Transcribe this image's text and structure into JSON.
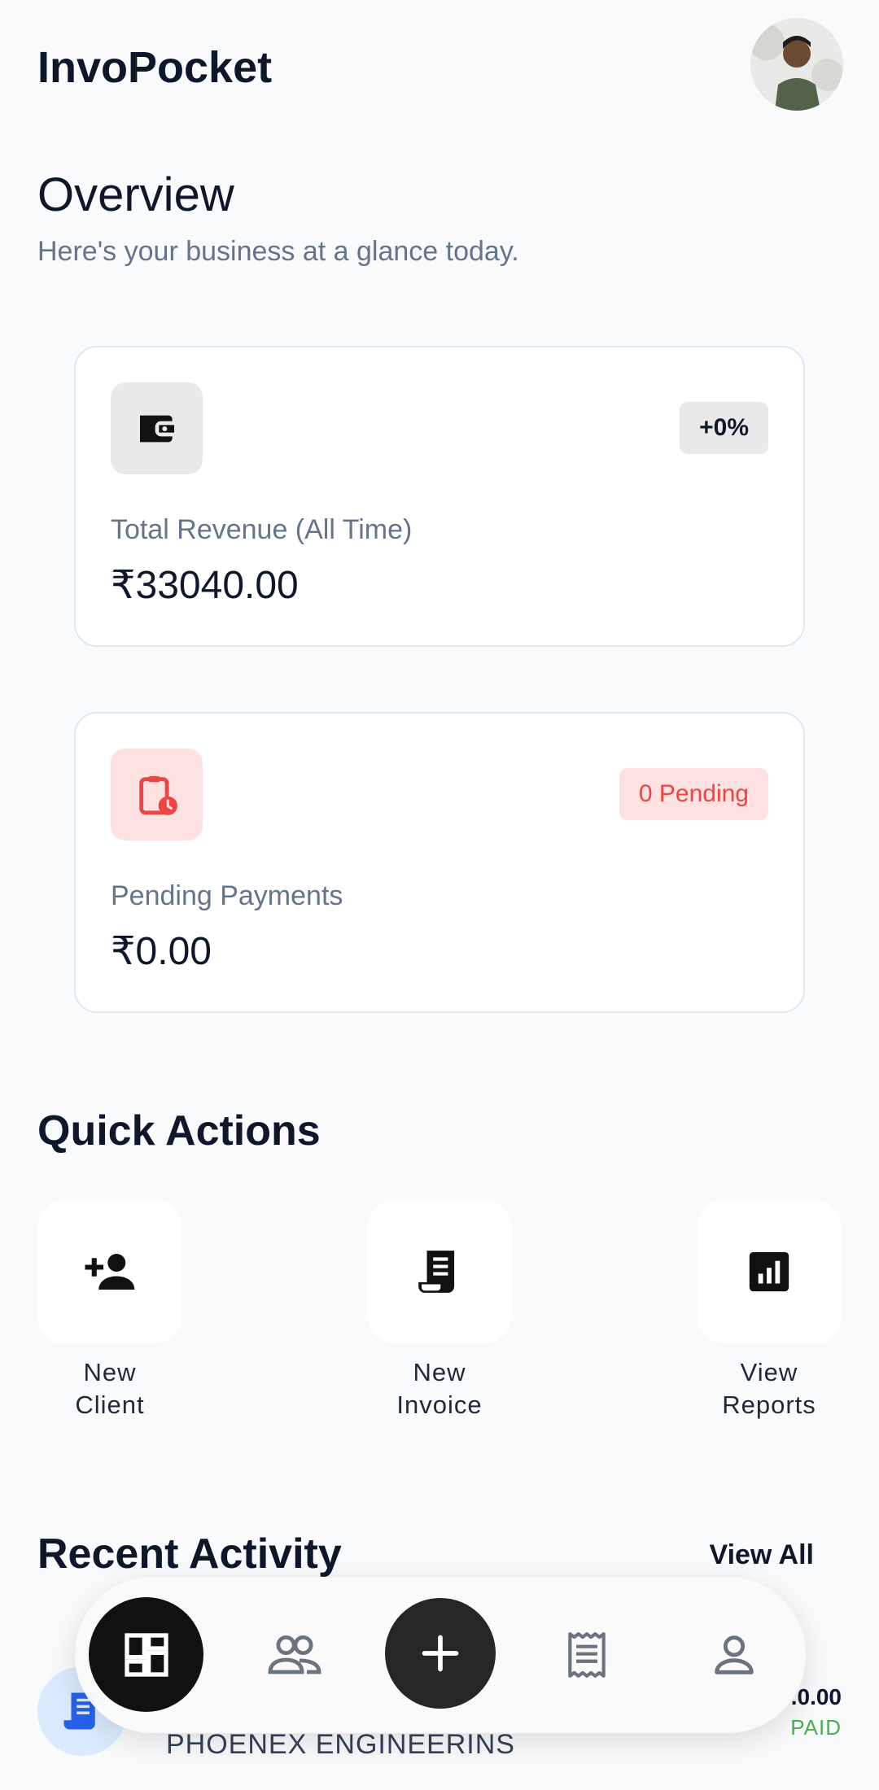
{
  "header": {
    "app_title": "InvoPocket"
  },
  "overview": {
    "title": "Overview",
    "subtitle": "Here's your business at a glance today."
  },
  "cards": {
    "revenue": {
      "badge": "+0%",
      "label": "Total Revenue (All Time)",
      "amount": "₹33040.00",
      "icon": "wallet-icon"
    },
    "pending": {
      "badge": "0 Pending",
      "label": "Pending Payments",
      "amount": "₹0.00",
      "icon": "clipboard-clock-icon"
    }
  },
  "quick_actions": {
    "title": "Quick Actions",
    "items": [
      {
        "label": "New\nClient",
        "icon": "add-person-icon"
      },
      {
        "label": "New\nInvoice",
        "icon": "receipt-icon"
      },
      {
        "label": "View\nReports",
        "icon": "bar-chart-icon"
      }
    ]
  },
  "recent_activity": {
    "title": "Recent Activity",
    "view_all": "View All",
    "items": [
      {
        "name": "PHOENEX ENGINEERINS",
        "amount": ".0.00",
        "status": "PAID",
        "icon": "receipt-icon"
      }
    ]
  },
  "colors": {
    "accent_dark": "#111111",
    "pending_red": "#ef4444",
    "paid_green": "#4caf50"
  },
  "nav": {
    "items": [
      "dashboard-icon",
      "clients-icon",
      "add-icon",
      "invoices-icon",
      "profile-icon"
    ]
  }
}
